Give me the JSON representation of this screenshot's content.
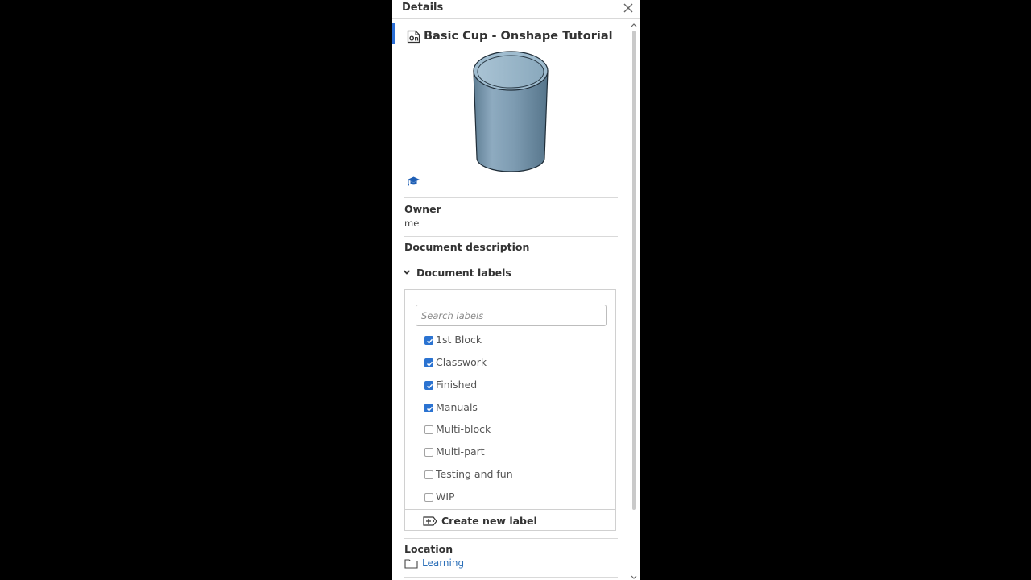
{
  "panel": {
    "title": "Details"
  },
  "document": {
    "title": "Basic Cup - Onshape Tutorial",
    "doc_icon_text": "On"
  },
  "owner": {
    "heading": "Owner",
    "value": "me"
  },
  "description": {
    "heading": "Document description"
  },
  "labels": {
    "heading": "Document labels",
    "search_placeholder": "Search labels",
    "items": [
      {
        "label": "1st Block",
        "checked": true
      },
      {
        "label": "Classwork",
        "checked": true
      },
      {
        "label": "Finished",
        "checked": true
      },
      {
        "label": "Manuals",
        "checked": true
      },
      {
        "label": "Multi-block",
        "checked": false
      },
      {
        "label": "Multi-part",
        "checked": false
      },
      {
        "label": "Testing and fun",
        "checked": false
      },
      {
        "label": "WIP",
        "checked": false
      }
    ],
    "create_label": "Create new label"
  },
  "location": {
    "heading": "Location",
    "folder": "Learning"
  },
  "icons": {
    "close": "close-icon",
    "document": "onshape-document-icon",
    "education": "graduation-cap-icon",
    "chevron": "chevron-down-icon",
    "checkbox": "check-icon",
    "create_label": "add-label-icon",
    "folder": "folder-icon"
  },
  "colors": {
    "background": "#000000",
    "panel": "#ffffff",
    "accent": "#2b73d1",
    "text": "#333333",
    "link": "#2b6fb8",
    "cup_body": "#7f9db3"
  }
}
